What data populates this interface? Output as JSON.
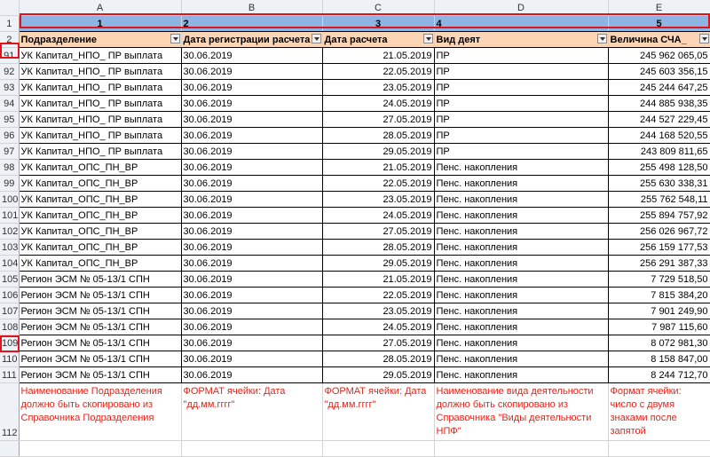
{
  "columns": [
    "A",
    "B",
    "C",
    "D",
    "E"
  ],
  "row1": {
    "num": "1",
    "cells": [
      "1",
      "2",
      "3",
      "4",
      "5"
    ]
  },
  "row2": {
    "num": "2",
    "cells": [
      "Подразделение",
      "Дата регистрации расчета",
      "Дата расчета",
      "Вид деят",
      "Величина СЧА_"
    ]
  },
  "rows": [
    {
      "num": "91",
      "cells": [
        "УК Капитал_НПО_ ПР выплата",
        "30.06.2019",
        "21.05.2019",
        "ПР",
        "245 962 065,05"
      ]
    },
    {
      "num": "92",
      "cells": [
        "УК Капитал_НПО_ ПР выплата",
        "30.06.2019",
        "22.05.2019",
        "ПР",
        "245 603 356,15"
      ]
    },
    {
      "num": "93",
      "cells": [
        "УК Капитал_НПО_ ПР выплата",
        "30.06.2019",
        "23.05.2019",
        "ПР",
        "245 244 647,25"
      ]
    },
    {
      "num": "94",
      "cells": [
        "УК Капитал_НПО_ ПР выплата",
        "30.06.2019",
        "24.05.2019",
        "ПР",
        "244 885 938,35"
      ]
    },
    {
      "num": "95",
      "cells": [
        "УК Капитал_НПО_ ПР выплата",
        "30.06.2019",
        "27.05.2019",
        "ПР",
        "244 527 229,45"
      ]
    },
    {
      "num": "96",
      "cells": [
        "УК Капитал_НПО_ ПР выплата",
        "30.06.2019",
        "28.05.2019",
        "ПР",
        "244 168 520,55"
      ]
    },
    {
      "num": "97",
      "cells": [
        "УК Капитал_НПО_ ПР выплата",
        "30.06.2019",
        "29.05.2019",
        "ПР",
        "243 809 811,65"
      ]
    },
    {
      "num": "98",
      "cells": [
        "УК Капитал_ОПС_ПН_ВР",
        "30.06.2019",
        "21.05.2019",
        "Пенс. накопления",
        "255 498 128,50"
      ]
    },
    {
      "num": "99",
      "cells": [
        "УК Капитал_ОПС_ПН_ВР",
        "30.06.2019",
        "22.05.2019",
        "Пенс. накопления",
        "255 630 338,31"
      ]
    },
    {
      "num": "100",
      "cells": [
        "УК Капитал_ОПС_ПН_ВР",
        "30.06.2019",
        "23.05.2019",
        "Пенс. накопления",
        "255 762 548,11"
      ]
    },
    {
      "num": "101",
      "cells": [
        "УК Капитал_ОПС_ПН_ВР",
        "30.06.2019",
        "24.05.2019",
        "Пенс. накопления",
        "255 894 757,92"
      ]
    },
    {
      "num": "102",
      "cells": [
        "УК Капитал_ОПС_ПН_ВР",
        "30.06.2019",
        "27.05.2019",
        "Пенс. накопления",
        "256 026 967,72"
      ]
    },
    {
      "num": "103",
      "cells": [
        "УК Капитал_ОПС_ПН_ВР",
        "30.06.2019",
        "28.05.2019",
        "Пенс. накопления",
        "256 159 177,53"
      ]
    },
    {
      "num": "104",
      "cells": [
        "УК Капитал_ОПС_ПН_ВР",
        "30.06.2019",
        "29.05.2019",
        "Пенс. накопления",
        "256 291 387,33"
      ]
    },
    {
      "num": "105",
      "cells": [
        "Регион ЭСМ № 05-13/1 СПН",
        "30.06.2019",
        "21.05.2019",
        "Пенс. накопления",
        "7 729 518,50"
      ]
    },
    {
      "num": "106",
      "cells": [
        "Регион ЭСМ № 05-13/1 СПН",
        "30.06.2019",
        "22.05.2019",
        "Пенс. накопления",
        "7 815 384,20"
      ]
    },
    {
      "num": "107",
      "cells": [
        "Регион ЭСМ № 05-13/1 СПН",
        "30.06.2019",
        "23.05.2019",
        "Пенс. накопления",
        "7 901 249,90"
      ]
    },
    {
      "num": "108",
      "cells": [
        "Регион ЭСМ № 05-13/1 СПН",
        "30.06.2019",
        "24.05.2019",
        "Пенс. накопления",
        "7 987 115,60"
      ]
    },
    {
      "num": "109",
      "cells": [
        "Регион ЭСМ № 05-13/1 СПН",
        "30.06.2019",
        "27.05.2019",
        "Пенс. накопления",
        "8 072 981,30"
      ]
    },
    {
      "num": "110",
      "cells": [
        "Регион ЭСМ № 05-13/1 СПН",
        "30.06.2019",
        "28.05.2019",
        "Пенс. накопления",
        "8 158 847,00"
      ]
    },
    {
      "num": "111",
      "cells": [
        "Регион ЭСМ № 05-13/1 СПН",
        "30.06.2019",
        "29.05.2019",
        "Пенс. накопления",
        "8 244 712,70"
      ]
    }
  ],
  "notes_row": {
    "num": "112",
    "cells": [
      "Наименование Подразделения должно быть скопировано из Справочника Подразделения",
      "ФОРМАТ ячейки: Дата \"дд.мм.гггг\"",
      "ФОРМАТ ячейки: Дата \"дд.мм.гггг\"",
      "Наименование вида деятельности должно быть скопировано из Справочника \"Виды деятельности НПФ\"",
      "Формат ячейки: число с двумя знаками после запятой"
    ]
  },
  "colors": {
    "header_row_blue": "#8db4e2",
    "header_row_peach": "#fcd5b4",
    "note_text_red": "#e0261b",
    "highlight_red": "#e0151b"
  }
}
